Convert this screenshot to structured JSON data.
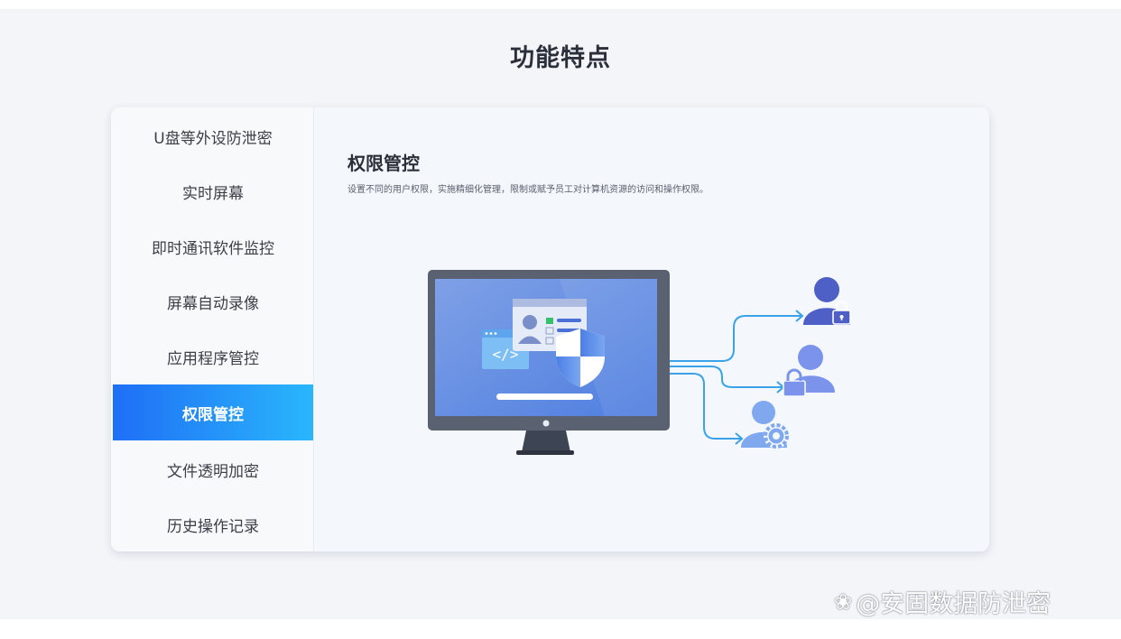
{
  "page": {
    "title": "功能特点"
  },
  "sidebar": {
    "items": [
      {
        "label": "U盘等外设防泄密",
        "active": false
      },
      {
        "label": "实时屏幕",
        "active": false
      },
      {
        "label": "即时通讯软件监控",
        "active": false
      },
      {
        "label": "屏幕自动录像",
        "active": false
      },
      {
        "label": "应用程序管控",
        "active": false
      },
      {
        "label": "权限管控",
        "active": true
      },
      {
        "label": "文件透明加密",
        "active": false
      },
      {
        "label": "历史操作记录",
        "active": false
      }
    ]
  },
  "content": {
    "title": "权限管控",
    "description": "设置不同的用户权限，实施精细化管理，限制或赋予员工对计算机资源的访问和操作权限。",
    "illustration": {
      "icons": [
        "monitor-icon",
        "user-card-icon",
        "shield-icon",
        "code-window-icon",
        "user-lock-icon",
        "user-gear-icon"
      ]
    }
  },
  "colors": {
    "accent_start": "#1f6ff5",
    "accent_end": "#29b6fc",
    "arrow": "#3aa3e8"
  },
  "watermark": {
    "icon": "weibo-icon",
    "text": "@安固数据防泄密"
  }
}
